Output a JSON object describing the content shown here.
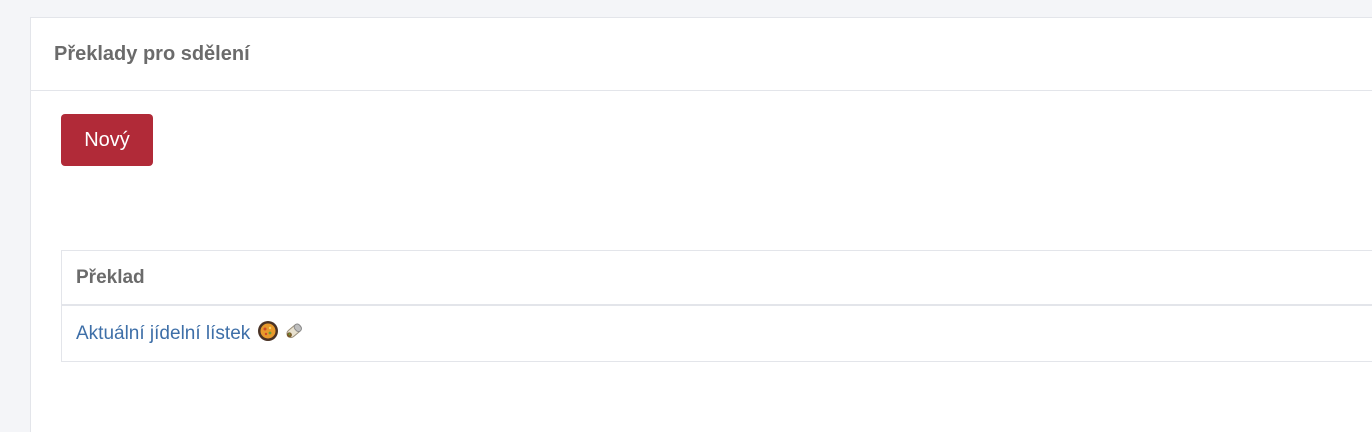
{
  "panel": {
    "title": "Překlady pro sdělení"
  },
  "toolbar": {
    "new_label": "Nový"
  },
  "table": {
    "columns": [
      "Překlad"
    ],
    "rows": [
      {
        "text": "Aktuální jídelní lístek",
        "icons": [
          "paella-pan-icon",
          "burrito-icon"
        ]
      }
    ]
  },
  "colors": {
    "accent": "#b12a38",
    "link": "#3e6fa8",
    "page_bg": "#f4f5f8"
  }
}
